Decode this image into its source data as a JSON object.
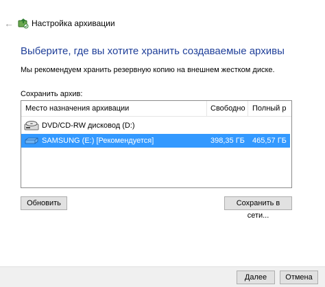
{
  "window": {
    "title": "Настройка архивации",
    "back_icon": "arrow-left-icon",
    "app_icon": "backup-icon"
  },
  "main": {
    "heading": "Выберите, где вы хотите хранить создаваемые архивы",
    "recommend_text": "Мы рекомендуем хранить резервную копию на внешнем жестком диске.",
    "save_label": "Сохранить архив:"
  },
  "table": {
    "columns": [
      "Место назначения архивации",
      "Свободно",
      "Полный р"
    ],
    "rows": [
      {
        "icon": "dvd-drive-icon",
        "name": "DVD/CD-RW дисковод (D:)",
        "free": "",
        "total": "",
        "selected": false
      },
      {
        "icon": "hard-drive-icon",
        "name": "SAMSUNG (E:) [Рекомендуется]",
        "free": "398,35 ГБ",
        "total": "465,57 ГБ",
        "selected": true
      }
    ]
  },
  "buttons": {
    "refresh": "Обновить",
    "save_network": "Сохранить в сети...",
    "next": "Далее",
    "cancel": "Отмена"
  },
  "colors": {
    "accent_heading": "#1f3f99",
    "selection": "#3399ff"
  }
}
